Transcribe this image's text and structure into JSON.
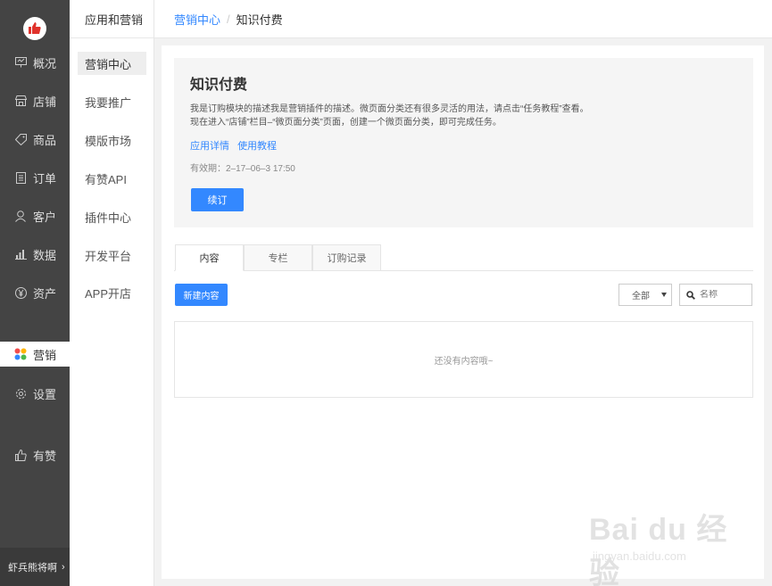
{
  "sidebar": {
    "items": [
      {
        "label": "概况",
        "icon": "monitor-icon"
      },
      {
        "label": "店铺",
        "icon": "store-icon"
      },
      {
        "label": "商品",
        "icon": "tag-icon"
      },
      {
        "label": "订单",
        "icon": "list-icon"
      },
      {
        "label": "客户",
        "icon": "person-icon"
      },
      {
        "label": "数据",
        "icon": "bar-chart-icon"
      },
      {
        "label": "资产",
        "icon": "yen-icon"
      },
      {
        "label": "营销",
        "icon": "marketing-icon"
      },
      {
        "label": "设置",
        "icon": "gear-icon"
      },
      {
        "label": "有赞",
        "icon": "thumbs-up-icon"
      }
    ],
    "active": "营销",
    "user": "虾兵熊将啊",
    "user_chevron": "›",
    "brand_color": "#e0322b"
  },
  "subnav": {
    "title": "应用和营销",
    "items": [
      "营销中心",
      "我要推广",
      "模版市场",
      "有赞API",
      "插件中心",
      "开发平台",
      "APP开店"
    ],
    "active": "营销中心"
  },
  "breadcrumb": {
    "parent": "营销中心",
    "separator": "/",
    "current": "知识付费"
  },
  "info": {
    "title": "知识付费",
    "desc1": "我是订购模块的描述我是营销插件的描述。微页面分类还有很多灵活的用法，请点击“任务教程”查看。",
    "desc2": "现在进入“店铺”栏目–“微页面分类”页面，创建一个微页面分类，即可完成任务。",
    "link_detail": "应用详情",
    "link_tutorial": "使用教程",
    "validity": "有效期：2–17–06–3 17:50",
    "renew_label": "续订"
  },
  "tabs": [
    "内容",
    "专栏",
    "订购记录"
  ],
  "active_tab": "内容",
  "toolbar": {
    "new_label": "新建内容",
    "filter_value": "全部",
    "search_placeholder": "名称"
  },
  "empty_text": "还没有内容哦~",
  "watermark": {
    "big": "Bai du 经验",
    "small": "jingyan.baidu.com"
  },
  "colors": {
    "accent": "#3388ff",
    "sidebar_bg": "#444444"
  }
}
